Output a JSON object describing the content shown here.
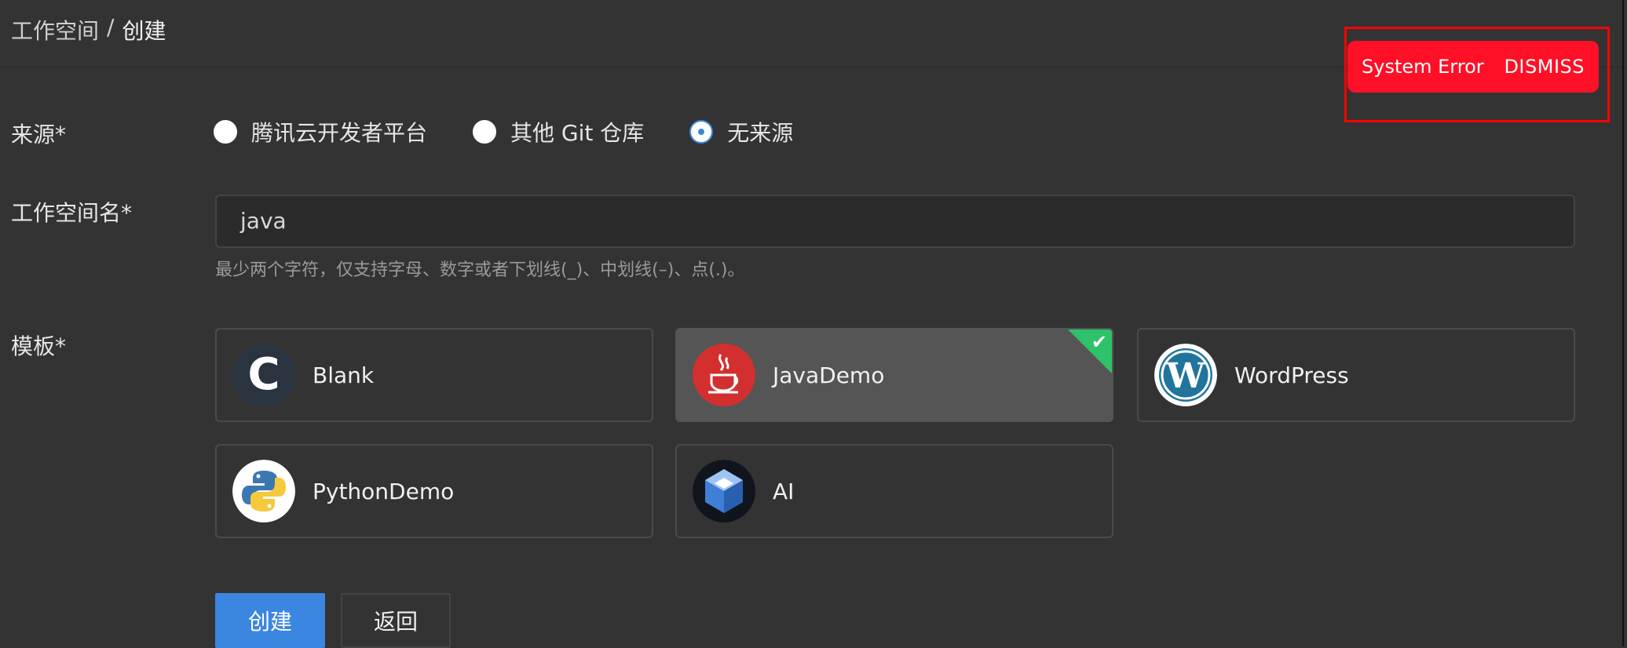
{
  "breadcrumb": {
    "root": "工作空间",
    "separator": "/",
    "current": "创建"
  },
  "source": {
    "label": "来源*",
    "options": [
      {
        "label": "腾讯云开发者平台",
        "checked": false
      },
      {
        "label": "其他 Git 仓库",
        "checked": false
      },
      {
        "label": "无来源",
        "checked": true
      }
    ]
  },
  "workspace_name": {
    "label": "工作空间名*",
    "value": "java",
    "hint": "最少两个字符，仅支持字母、数字或者下划线(_)、中划线(–)、点(.)。"
  },
  "template": {
    "label": "模板*",
    "items": [
      {
        "name": "Blank",
        "icon": "blank-c-icon",
        "selected": false
      },
      {
        "name": "JavaDemo",
        "icon": "java-icon",
        "selected": true
      },
      {
        "name": "WordPress",
        "icon": "wordpress-icon",
        "selected": false
      },
      {
        "name": "PythonDemo",
        "icon": "python-icon",
        "selected": false
      },
      {
        "name": "AI",
        "icon": "ai-cube-icon",
        "selected": false
      }
    ]
  },
  "actions": {
    "create": "创建",
    "back": "返回"
  },
  "toast": {
    "message": "System Error",
    "dismiss": "DISMISS"
  },
  "colors": {
    "accent": "#3b86e0",
    "error": "#ff1026",
    "selected_check": "#2fc26a",
    "background": "#333333"
  }
}
